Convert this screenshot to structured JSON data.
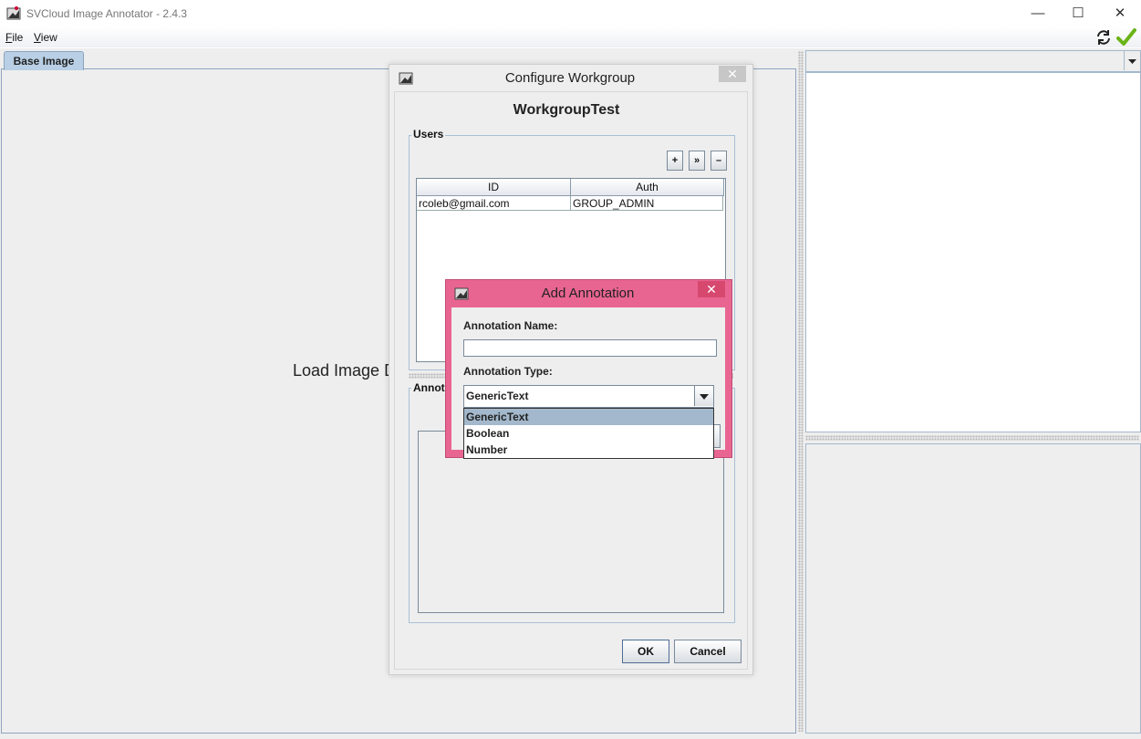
{
  "window": {
    "title": "SVCloud Image Annotator - 2.4.3",
    "controls": {
      "minimize": "—",
      "maximize": "☐",
      "close": "✕"
    }
  },
  "menubar": {
    "file": {
      "mnemonic": "F",
      "rest": "ile"
    },
    "view": {
      "mnemonic": "V",
      "rest": "iew"
    }
  },
  "tabs": {
    "base_image": "Base Image"
  },
  "main": {
    "load_text": "Load Image D"
  },
  "configure_workgroup": {
    "title": "Configure Workgroup",
    "close": "✕",
    "workgroup_name": "WorkgroupTest",
    "users_legend": "Users",
    "user_buttons": {
      "add": "+",
      "forward": "»",
      "remove": "–"
    },
    "users_table": {
      "headers": [
        "ID",
        "Auth"
      ],
      "rows": [
        {
          "id": "rcoleb@gmail.com",
          "auth": "GROUP_ADMIN"
        }
      ]
    },
    "annotations_legend": "Annot",
    "ok": "OK",
    "cancel": "Cancel"
  },
  "add_annotation": {
    "title": "Add Annotation",
    "close": "✕",
    "name_label": "Annotation Name:",
    "name_value": "",
    "type_label": "Annotation Type:",
    "type_selected": "GenericText",
    "type_options": [
      "GenericText",
      "Boolean",
      "Number"
    ]
  },
  "colors": {
    "dialog_highlight": "#e96591",
    "selection": "#a3b8cc",
    "tab_active": "#b8cfe5",
    "check": "#6ab417"
  }
}
